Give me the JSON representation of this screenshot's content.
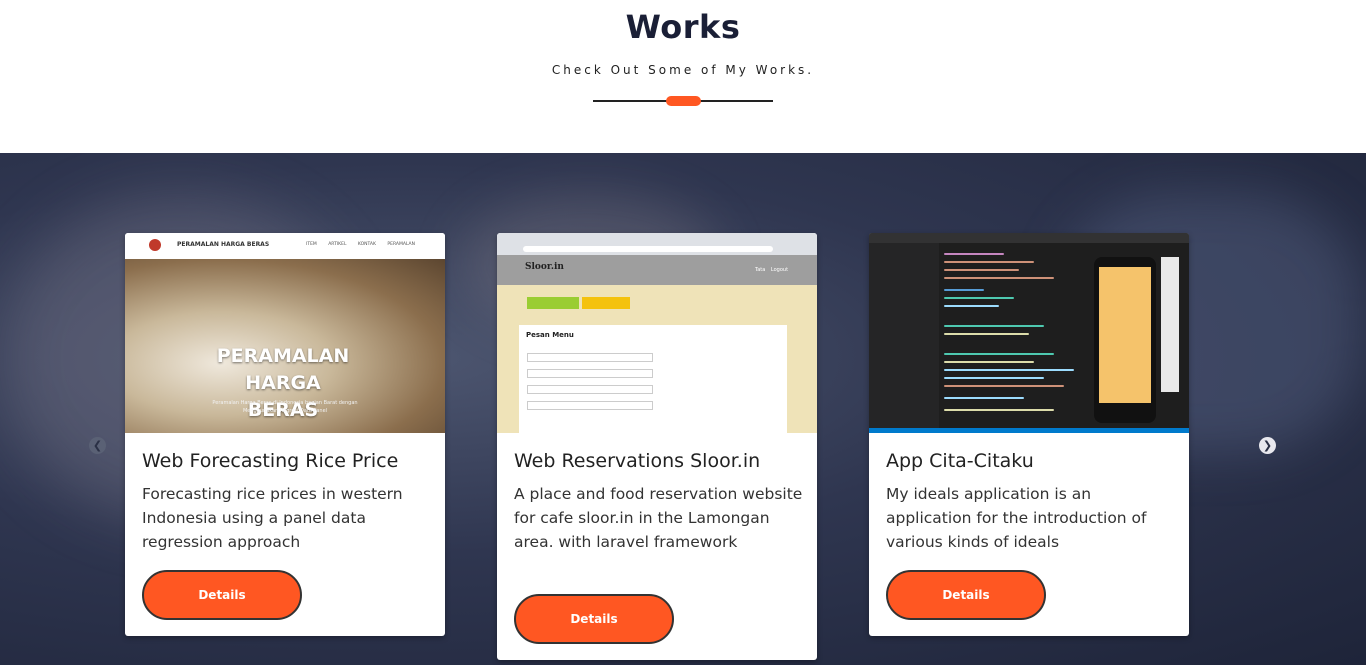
{
  "header": {
    "title": "Works",
    "subtitle": "Check Out Some of My Works."
  },
  "carousel": {
    "prev_icon": "chevron-left-icon",
    "next_icon": "chevron-right-icon",
    "prev_glyph": "❮",
    "next_glyph": "❯"
  },
  "cards": [
    {
      "title": "Web Forecasting Rice Price",
      "description": "Forecasting rice prices in western Indonesia using a panel data regression approach",
      "button_label": "Details",
      "thumbnail": {
        "brand": "PERAMALAN HARGA BERAS",
        "nav": "ITEM ARTIKEL KONTAK PERAMALAN",
        "headline": "PERAMALAN HARGA BERAS",
        "tagline": "Peramalan Harga Beras di Indonesia bagian Barat dengan Menggunakan Regresi Data Panel"
      }
    },
    {
      "title": "Web Reservations Sloor.in",
      "description": "A place and food reservation website for cafe sloor.in in the Lamongan area. with laravel framework",
      "button_label": "Details",
      "thumbnail": {
        "brand": "Sloor.in",
        "nav": "Tata Logout",
        "button1": "Tambahkan Tempat",
        "button2": "Tambahkan Menu",
        "form_title": "Pesan Menu"
      }
    },
    {
      "title": "App Cita-Citaku",
      "description": "My ideals application is an application for the introduction of various kinds of ideals",
      "button_label": "Details"
    }
  ],
  "colors": {
    "accent": "#ff5722",
    "title": "#1a1f36",
    "band": "#2f3650"
  }
}
